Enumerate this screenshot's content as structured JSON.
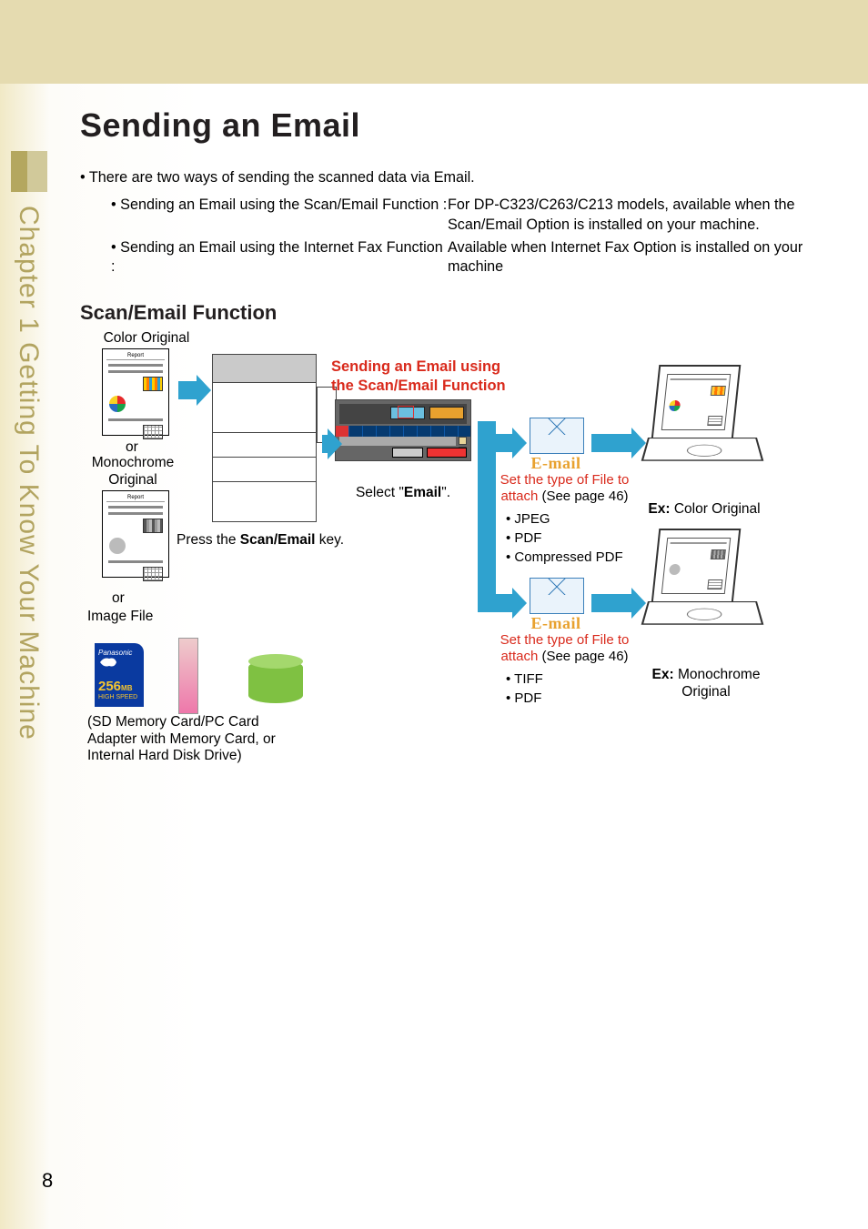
{
  "page": {
    "number": "8",
    "title": "Sending an Email",
    "chapter_tab": "Chapter 1  Getting To Know Your Machine"
  },
  "intro": {
    "lead": "There are two ways of sending the scanned data via Email.",
    "items": [
      {
        "left": "Sending an Email using the Scan/Email Function :",
        "right": "For DP-C323/C263/C213 models, available when the Scan/Email Option is installed on your machine."
      },
      {
        "left": "Sending an Email using the Internet Fax Function :",
        "right": "Available when Internet Fax Option is installed on your machine"
      }
    ]
  },
  "section": {
    "title": "Scan/Email Function"
  },
  "diagram": {
    "color_original": "Color Original",
    "or1": "or",
    "mono_original": "Monochrome\nOriginal",
    "or2": "or",
    "image_file": "Image File",
    "press_key_pre": "Press the ",
    "press_key_bold": "Scan/Email",
    "press_key_post": " key.",
    "callout_title": "Sending an Email using\nthe Scan/Email Function",
    "select_pre": "Select \"",
    "select_bold": "Email",
    "select_post": "\".",
    "email_label": "E-mail",
    "attach1_line1": "Set the type of File to",
    "attach1_line2_pre": "attach ",
    "attach1_line2_post": "(See page 46)",
    "attach1_formats": [
      "JPEG",
      "PDF",
      "Compressed PDF"
    ],
    "attach2_line1": "Set the type of File to",
    "attach2_line2_pre": "attach ",
    "attach2_line2_post": "(See page 46)",
    "attach2_formats": [
      "TIFF",
      "PDF"
    ],
    "ex_color_pre": "Ex:",
    "ex_color": " Color Original",
    "ex_mono_pre": "Ex:",
    "ex_mono": " Monochrome\nOriginal",
    "sd_label": "Panasonic",
    "sd_cap": "256",
    "sd_cap_unit": "MB",
    "sd_hs": "HIGH SPEED",
    "sd_note": "(SD Memory Card/PC Card Adapter with Memory Card, or Internal Hard Disk Drive)",
    "report_tag": "Report"
  }
}
